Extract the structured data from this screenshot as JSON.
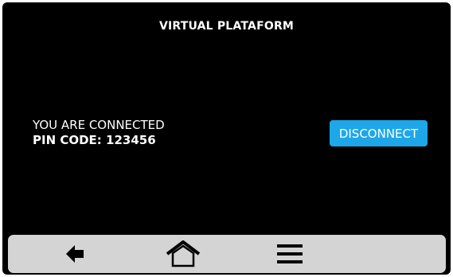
{
  "header": {
    "title": "VIRTUAL PLATAFORM"
  },
  "status": {
    "message": "YOU ARE CONNECTED",
    "pin": "PIN CODE: 123456"
  },
  "actions": {
    "disconnect_label": "DISCONNECT"
  },
  "navbar": {
    "items": [
      {
        "icon": "back-arrow-icon"
      },
      {
        "icon": "home-icon"
      },
      {
        "icon": "menu-icon"
      }
    ]
  },
  "colors": {
    "screen_bg": "#000000",
    "accent": "#1ea7e8",
    "navbar_bg": "#d4d4d4",
    "text": "#ffffff"
  }
}
